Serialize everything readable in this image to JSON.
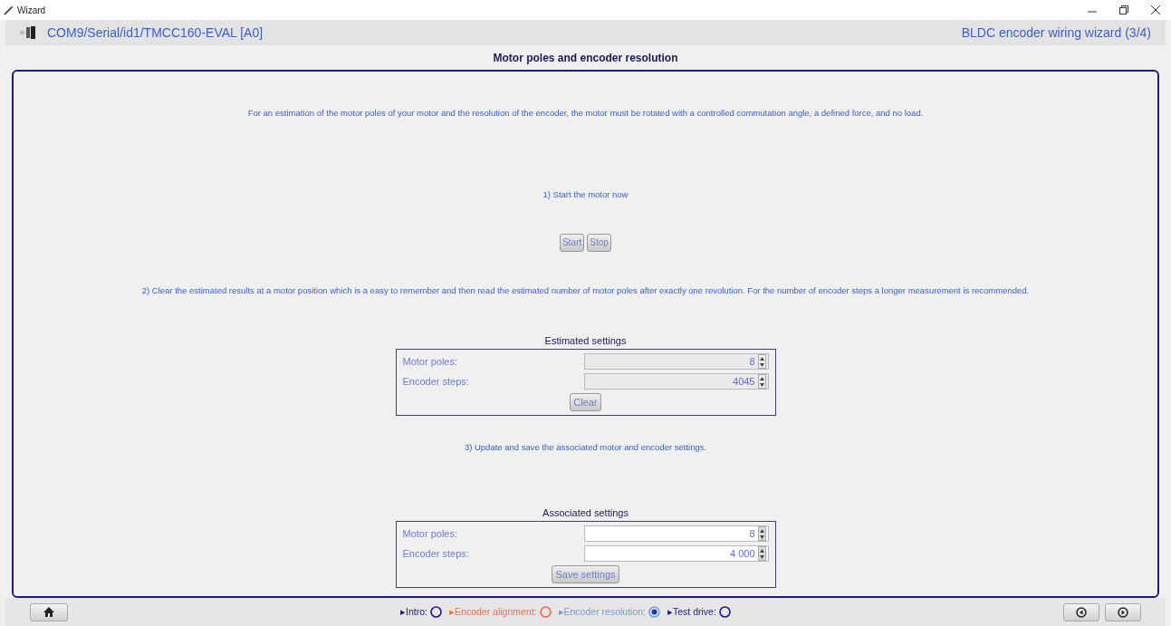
{
  "window": {
    "title": "Wizard"
  },
  "header": {
    "connection": "COM9/Serial/id1/TMCC160-EVAL [A0]",
    "wizard": "BLDC encoder wiring wizard (3/4)"
  },
  "page_title": "Motor poles and encoder resolution",
  "intro": "For an estimation of the motor poles of your motor and the resolution of the encoder, the motor must be rotated with a controlled commutation angle, a defined force, and no load.",
  "step1": {
    "text": "1) Start the motor now",
    "buttons": [
      "Start",
      "Stop"
    ]
  },
  "step2": {
    "text": "2) Clear the estimated results at a motor position which is a easy to remember and then read the estimated number of motor poles after exactly one revolution. For the number of encoder steps a longer measurement is recommended.",
    "group": {
      "title": "Estimated settings",
      "disabled": true,
      "fields": [
        {
          "label": "Motor poles:",
          "value": "8"
        },
        {
          "label": "Encoder steps:",
          "value": "4045"
        }
      ],
      "button": "Clear"
    }
  },
  "step3": {
    "text": "3) Update and save the associated motor and encoder settings.",
    "group": {
      "title": "Associated settings",
      "disabled": false,
      "fields": [
        {
          "label": "Motor poles:",
          "value": "8"
        },
        {
          "label": "Encoder steps:",
          "value": "4 000"
        }
      ],
      "button": "Save settings"
    }
  },
  "steps": [
    {
      "label": "▸Intro:",
      "color": "#1a1a8c",
      "selected": false
    },
    {
      "label": "▸Encoder alignment:",
      "color": "#f26b50",
      "selected": false
    },
    {
      "label": "▸Encoder resolution:",
      "color": "#7a9ad8",
      "selected": true
    },
    {
      "label": "▸Test drive:",
      "color": "#1a1a8c",
      "selected": false
    }
  ]
}
